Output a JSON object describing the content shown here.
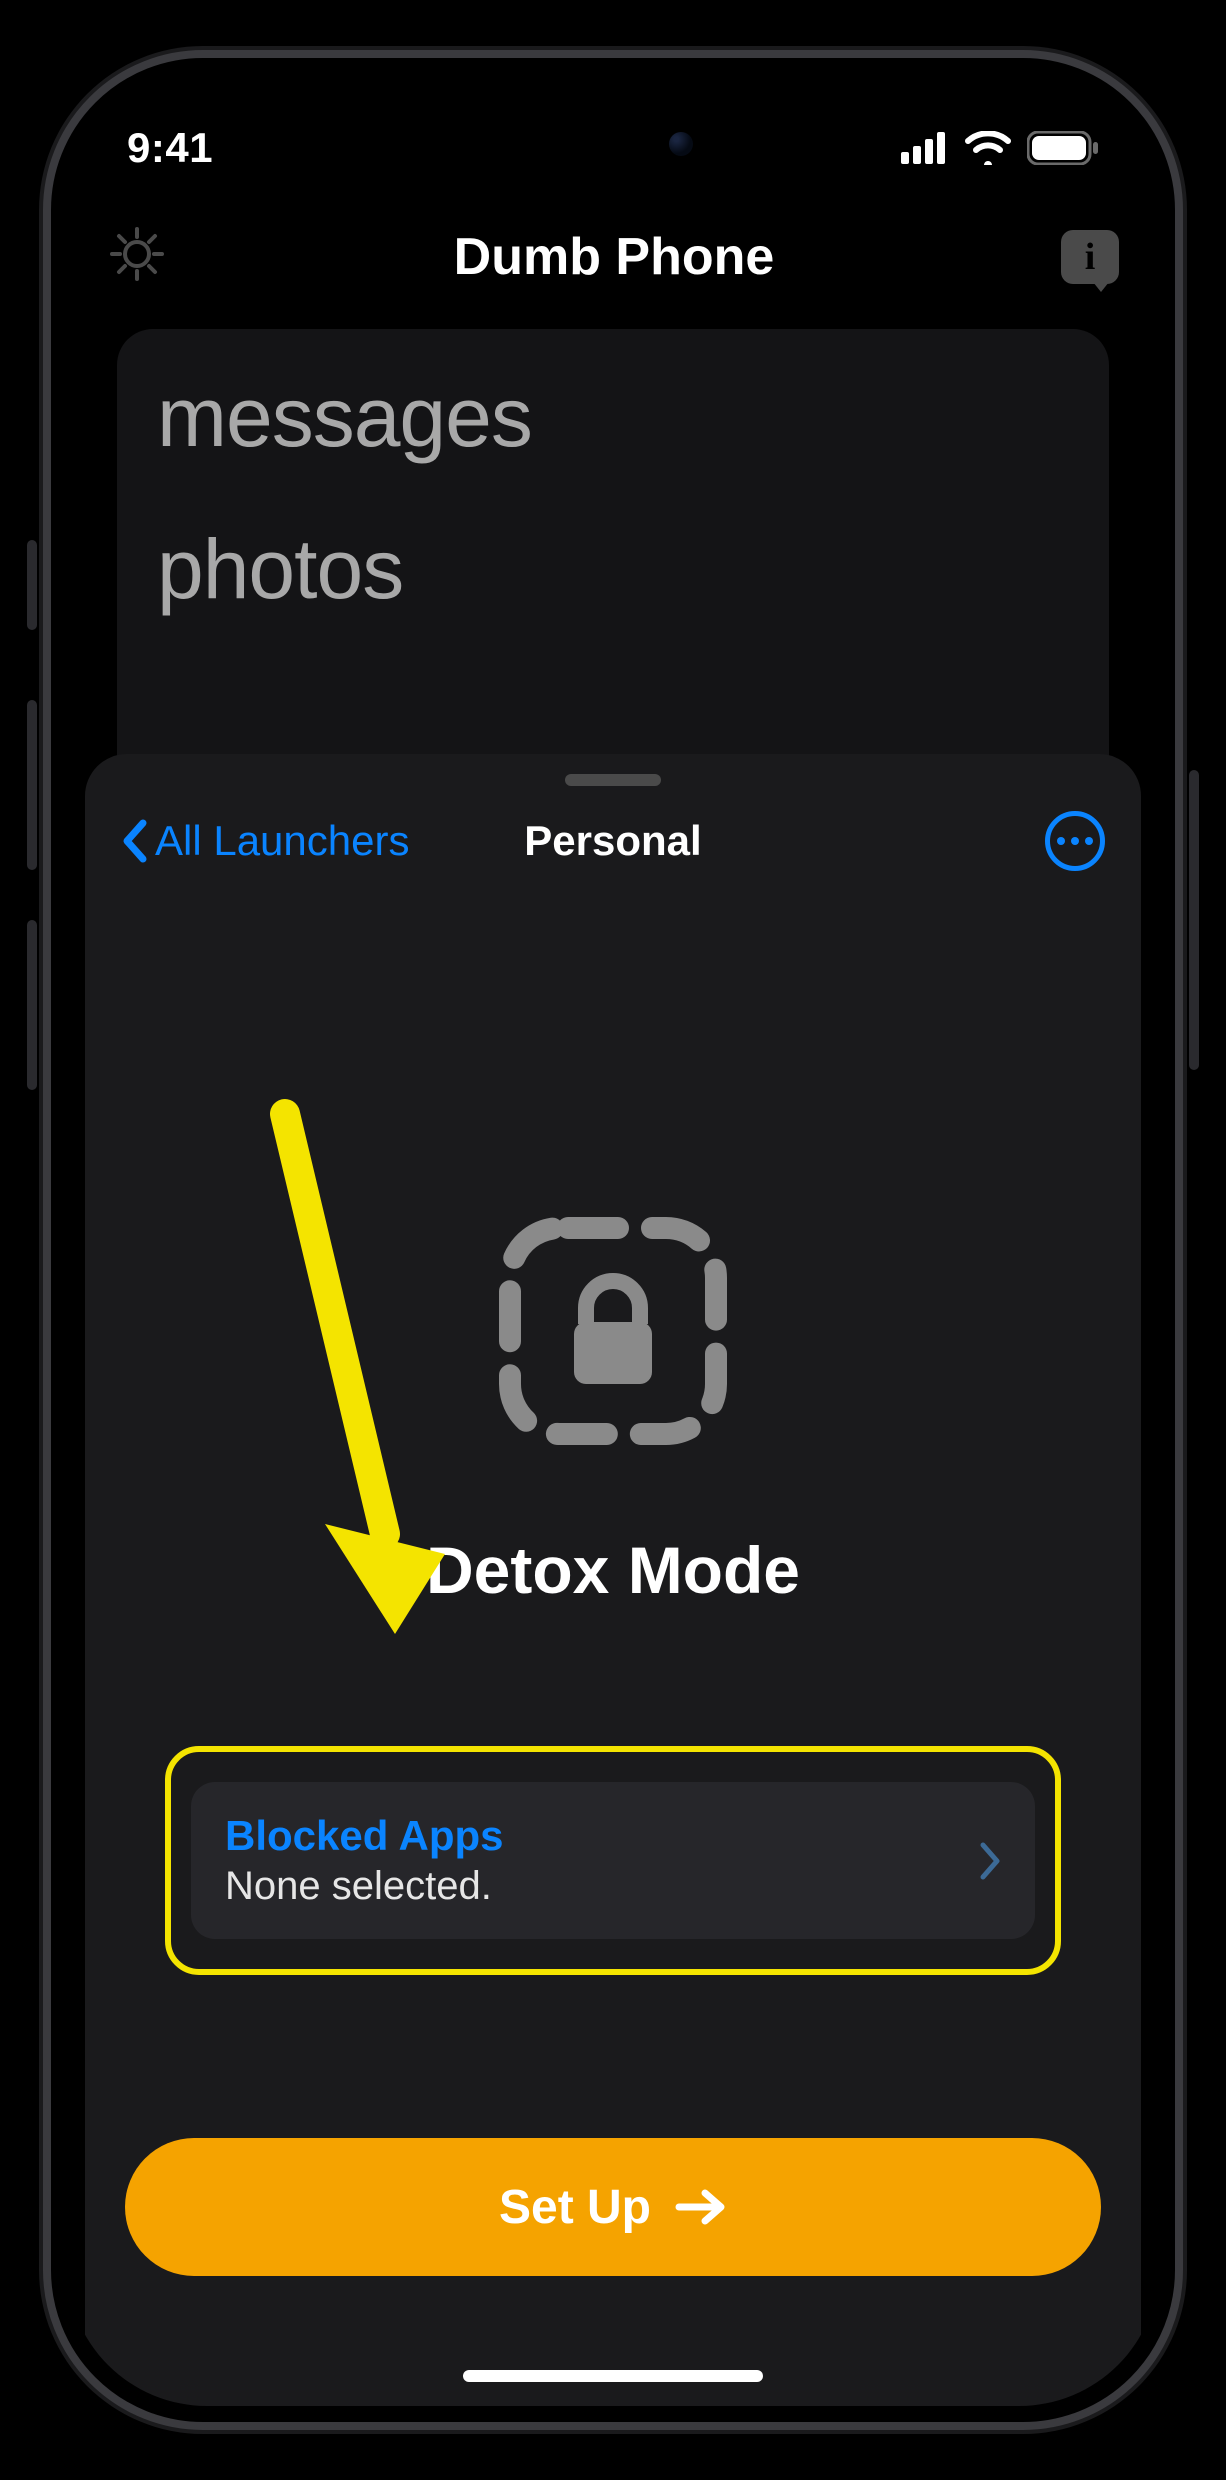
{
  "status": {
    "time": "9:41"
  },
  "header": {
    "title": "Dumb Phone"
  },
  "background_apps": {
    "item1": "messages",
    "item2": "photos"
  },
  "sheet": {
    "back_label": "All Launchers",
    "title": "Personal",
    "section_title": "Detox Mode",
    "blocked": {
      "title": "Blocked Apps",
      "subtitle": "None selected."
    },
    "setup_label": "Set Up"
  },
  "icons": {
    "info": "i"
  }
}
